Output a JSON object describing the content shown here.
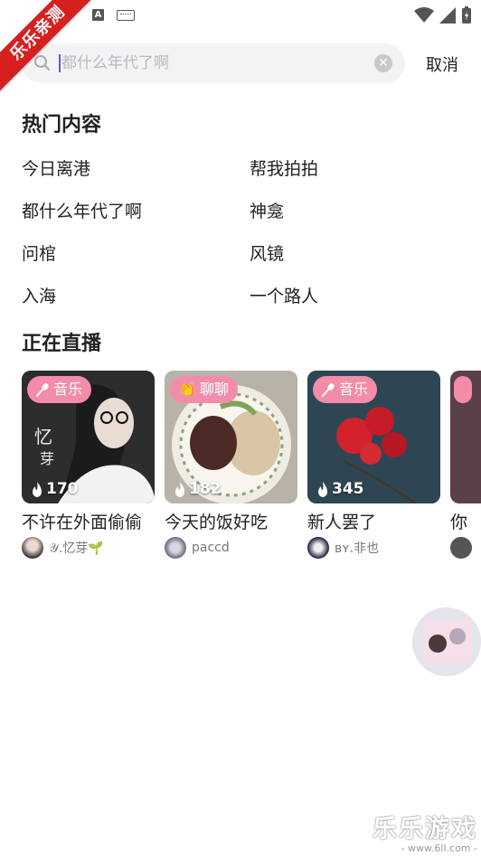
{
  "ribbon": "乐乐亲测",
  "status_bar": {
    "icon_a": "A"
  },
  "search": {
    "placeholder": "都什么年代了啊",
    "value": "",
    "cancel_label": "取消"
  },
  "hot": {
    "title": "热门内容",
    "items": [
      "今日离港",
      "帮我拍拍",
      "都什么年代了啊",
      "神龛",
      "问棺",
      "风镜",
      "入海",
      "一个路人"
    ]
  },
  "live": {
    "title": "正在直播",
    "cards": [
      {
        "tag": "音乐",
        "tag_icon": "microphone-icon",
        "viewers": "170",
        "title": "不许在外面偷偷",
        "host": "𝒴.忆芽🌱"
      },
      {
        "tag": "聊聊",
        "tag_icon": "clapping-hands-icon",
        "viewers": "182",
        "title": "今天的饭好吃",
        "host": "paccd"
      },
      {
        "tag": "音乐",
        "tag_icon": "microphone-icon",
        "viewers": "345",
        "title": "新人罢了",
        "host": "ʙʏ.非也"
      },
      {
        "tag": "",
        "tag_icon": "",
        "viewers": "",
        "title": "你",
        "host": ""
      }
    ]
  },
  "watermark": {
    "big": "乐乐游戏",
    "small": "- www.6ll.com -"
  },
  "colors": {
    "accent": "#6a4cff",
    "tag_pink": "#f38ca9",
    "ribbon_red": "#d62020"
  }
}
